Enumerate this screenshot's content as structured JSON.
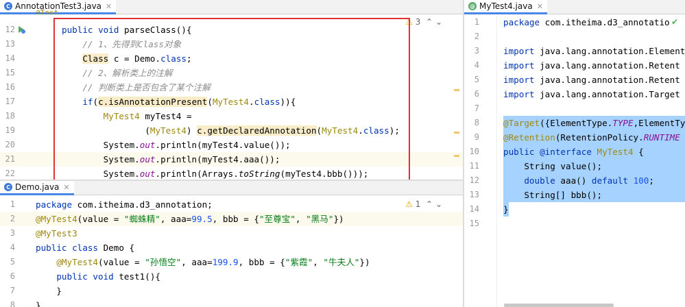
{
  "left_top": {
    "tab": {
      "label": "AnnotationTest3.java",
      "icon": "class-icon",
      "icon_letter": "C"
    },
    "warnings": {
      "count": "3"
    },
    "lines": [
      {
        "n": "12",
        "text": "    public void parseClass(){"
      },
      {
        "n": "13",
        "text": "        // 1、先得到Class对象"
      },
      {
        "n": "14",
        "text": "        Class c = Demo.class;"
      },
      {
        "n": "15",
        "text": "        // 2、解析类上的注解"
      },
      {
        "n": "16",
        "text": "        // 判断类上是否包含了某个注解"
      },
      {
        "n": "17",
        "text": "        if(c.isAnnotationPresent(MyTest4.class)){"
      },
      {
        "n": "18",
        "text": "            MyTest4 myTest4 ="
      },
      {
        "n": "19",
        "text": "                    (MyTest4) c.getDeclaredAnnotation(MyTest4.class);"
      },
      {
        "n": "20",
        "text": "            System.out.println(myTest4.value());"
      },
      {
        "n": "21",
        "text": "            System.out.println(myTest4.aaa());"
      },
      {
        "n": "22",
        "text": "            System.out.println(Arrays.toString(myTest4.bbb()));"
      }
    ],
    "partial_top": "@Test"
  },
  "left_bottom": {
    "tab": {
      "label": "Demo.java",
      "icon": "class-icon",
      "icon_letter": "C"
    },
    "warnings": {
      "count": "1"
    },
    "lines": [
      {
        "n": "1",
        "text": "package com.itheima.d3_annotation;"
      },
      {
        "n": "2",
        "text": "@MyTest4(value = \"蜘蛛精\", aaa=99.5, bbb = {\"至尊宝\", \"黑马\"})"
      },
      {
        "n": "3",
        "text": "@MyTest3"
      },
      {
        "n": "4",
        "text": "public class Demo {"
      },
      {
        "n": "5",
        "text": "    @MyTest4(value = \"孙悟空\", aaa=199.9, bbb = {\"紫霞\", \"牛夫人\"})"
      },
      {
        "n": "6",
        "text": "    public void test1(){"
      },
      {
        "n": "7",
        "text": "    }"
      },
      {
        "n": "8",
        "text": "}"
      }
    ]
  },
  "right": {
    "tab": {
      "label": "MyTest4.java",
      "icon": "annotation-icon",
      "icon_letter": "@"
    },
    "lines": [
      {
        "n": "1",
        "text": "package com.itheima.d3_annotatio"
      },
      {
        "n": "2",
        "text": ""
      },
      {
        "n": "3",
        "text": "import java.lang.annotation.Element"
      },
      {
        "n": "4",
        "text": "import java.lang.annotation.Retent"
      },
      {
        "n": "5",
        "text": "import java.lang.annotation.Retent"
      },
      {
        "n": "6",
        "text": "import java.lang.annotation.Target"
      },
      {
        "n": "7",
        "text": ""
      },
      {
        "n": "8",
        "text": "@Target({ElementType.TYPE,ElementTy"
      },
      {
        "n": "9",
        "text": "@Retention(RetentionPolicy.RUNTIME"
      },
      {
        "n": "10",
        "text": "public @interface MyTest4 {"
      },
      {
        "n": "11",
        "text": "    String value();"
      },
      {
        "n": "12",
        "text": "    double aaa() default 100;"
      },
      {
        "n": "13",
        "text": "    String[] bbb();"
      },
      {
        "n": "14",
        "text": "}"
      },
      {
        "n": "15",
        "text": ""
      }
    ]
  },
  "colors": {
    "keyword": "#0033b3",
    "annotation": "#9e880d",
    "string": "#067d17",
    "number": "#1750eb",
    "comment": "#8c8c8c",
    "selection": "#a6d2ff",
    "highlight_box": "#e03030"
  }
}
